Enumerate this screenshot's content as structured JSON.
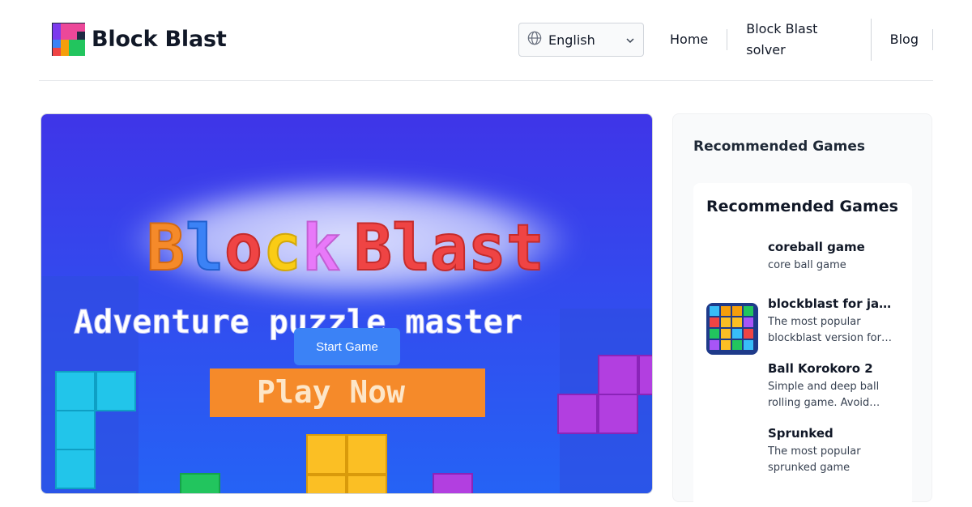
{
  "header": {
    "logo_text": "Block Blast",
    "language": {
      "selected": "English"
    },
    "nav": [
      "Home",
      "Block Blast solver",
      "Blog"
    ]
  },
  "game": {
    "banner_title": "Block Blast",
    "banner_subtitle": "Adventure puzzle master",
    "banner_cta": "Play Now",
    "start_button": "Start Game"
  },
  "sidebar": {
    "title": "Recommended Games",
    "card_title": "Recommended Games",
    "games": [
      {
        "name": "coreball game",
        "desc": "core ball game"
      },
      {
        "name": "blockblast for japan",
        "desc": "The most popular blockblast version for japan"
      },
      {
        "name": "Ball Korokoro 2",
        "desc": "Simple and deep ball rolling game. Avoid obstacles"
      },
      {
        "name": "Sprunked",
        "desc": "The most popular sprunked game"
      }
    ]
  },
  "colors": {
    "accent": "#3b82f6",
    "banner_bg": "#2e50f0",
    "cta_orange": "#f58a2a"
  }
}
